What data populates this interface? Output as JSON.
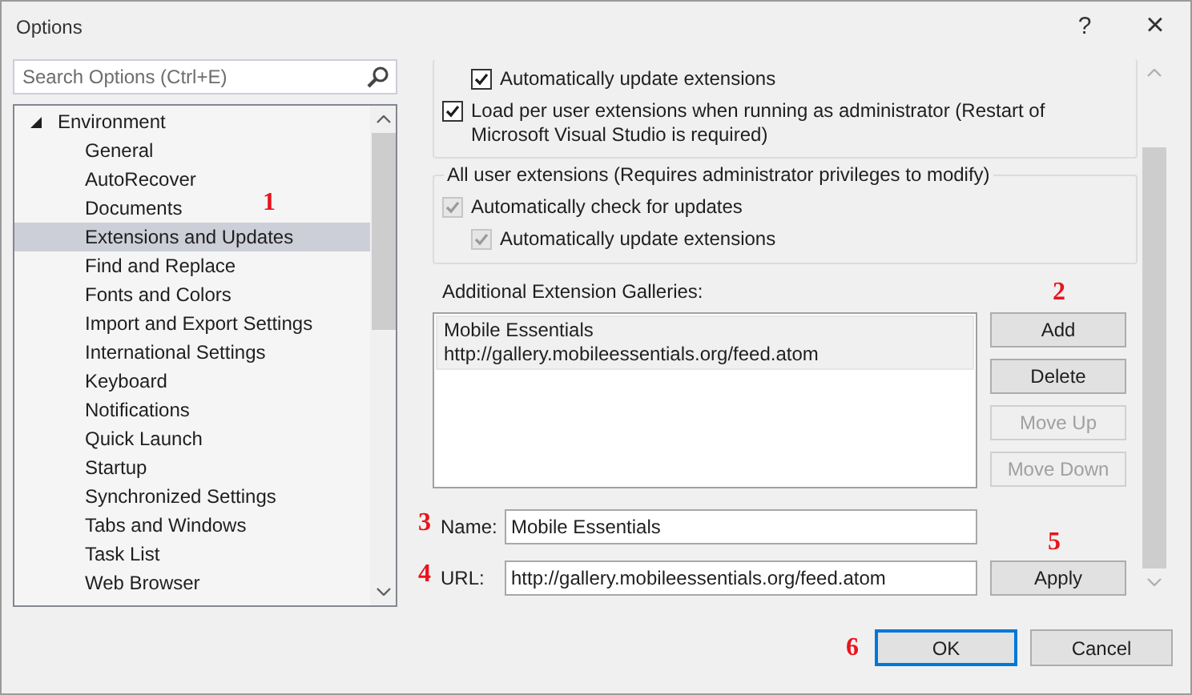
{
  "window": {
    "title": "Options",
    "help": "?",
    "close": "×"
  },
  "search": {
    "placeholder": "Search Options (Ctrl+E)"
  },
  "tree": [
    {
      "label": "Environment",
      "expanded": true,
      "selected": false,
      "children": [
        {
          "label": "General",
          "selected": false
        },
        {
          "label": "AutoRecover",
          "selected": false
        },
        {
          "label": "Documents",
          "selected": false
        },
        {
          "label": "Extensions and Updates",
          "selected": true
        },
        {
          "label": "Find and Replace",
          "selected": false
        },
        {
          "label": "Fonts and Colors",
          "selected": false
        },
        {
          "label": "Import and Export Settings",
          "selected": false
        },
        {
          "label": "International Settings",
          "selected": false
        },
        {
          "label": "Keyboard",
          "selected": false
        },
        {
          "label": "Notifications",
          "selected": false
        },
        {
          "label": "Quick Launch",
          "selected": false
        },
        {
          "label": "Startup",
          "selected": false
        },
        {
          "label": "Synchronized Settings",
          "selected": false
        },
        {
          "label": "Tabs and Windows",
          "selected": false
        },
        {
          "label": "Task List",
          "selected": false
        },
        {
          "label": "Web Browser",
          "selected": false
        }
      ]
    }
  ],
  "groups": [
    {
      "options": [
        {
          "label": "Automatically update extensions",
          "checked": true,
          "disabled": false,
          "kind": "sub"
        },
        {
          "label": "Load per user extensions when running as administrator (Restart of Microsoft Visual Studio is required)",
          "checked": true,
          "disabled": false,
          "kind": "main"
        }
      ]
    },
    {
      "title": "All user extensions (Requires administrator privileges to modify)",
      "options": [
        {
          "label": "Automatically check for updates",
          "checked": true,
          "disabled": true,
          "kind": "main"
        },
        {
          "label": "Automatically update extensions",
          "checked": true,
          "disabled": true,
          "kind": "sub"
        }
      ]
    }
  ],
  "galleries": {
    "label": "Additional Extension Galleries:",
    "items": [
      {
        "name": "Mobile Essentials",
        "url": "http://gallery.mobileessentials.org/feed.atom",
        "selected": true
      }
    ],
    "buttons": [
      {
        "label": "Add",
        "disabled": false
      },
      {
        "label": "Delete",
        "disabled": false
      },
      {
        "label": "Move Up",
        "disabled": true
      },
      {
        "label": "Move Down",
        "disabled": true
      }
    ]
  },
  "name_field": {
    "label": "Name:",
    "value": "Mobile Essentials"
  },
  "url_field": {
    "label": "URL:",
    "value": "http://gallery.mobileessentials.org/feed.atom"
  },
  "apply_button": {
    "label": "Apply"
  },
  "footer_buttons": [
    {
      "label": "OK",
      "default": true
    },
    {
      "label": "Cancel",
      "default": false
    }
  ],
  "callouts": [
    "1",
    "2",
    "3",
    "4",
    "5",
    "6"
  ]
}
